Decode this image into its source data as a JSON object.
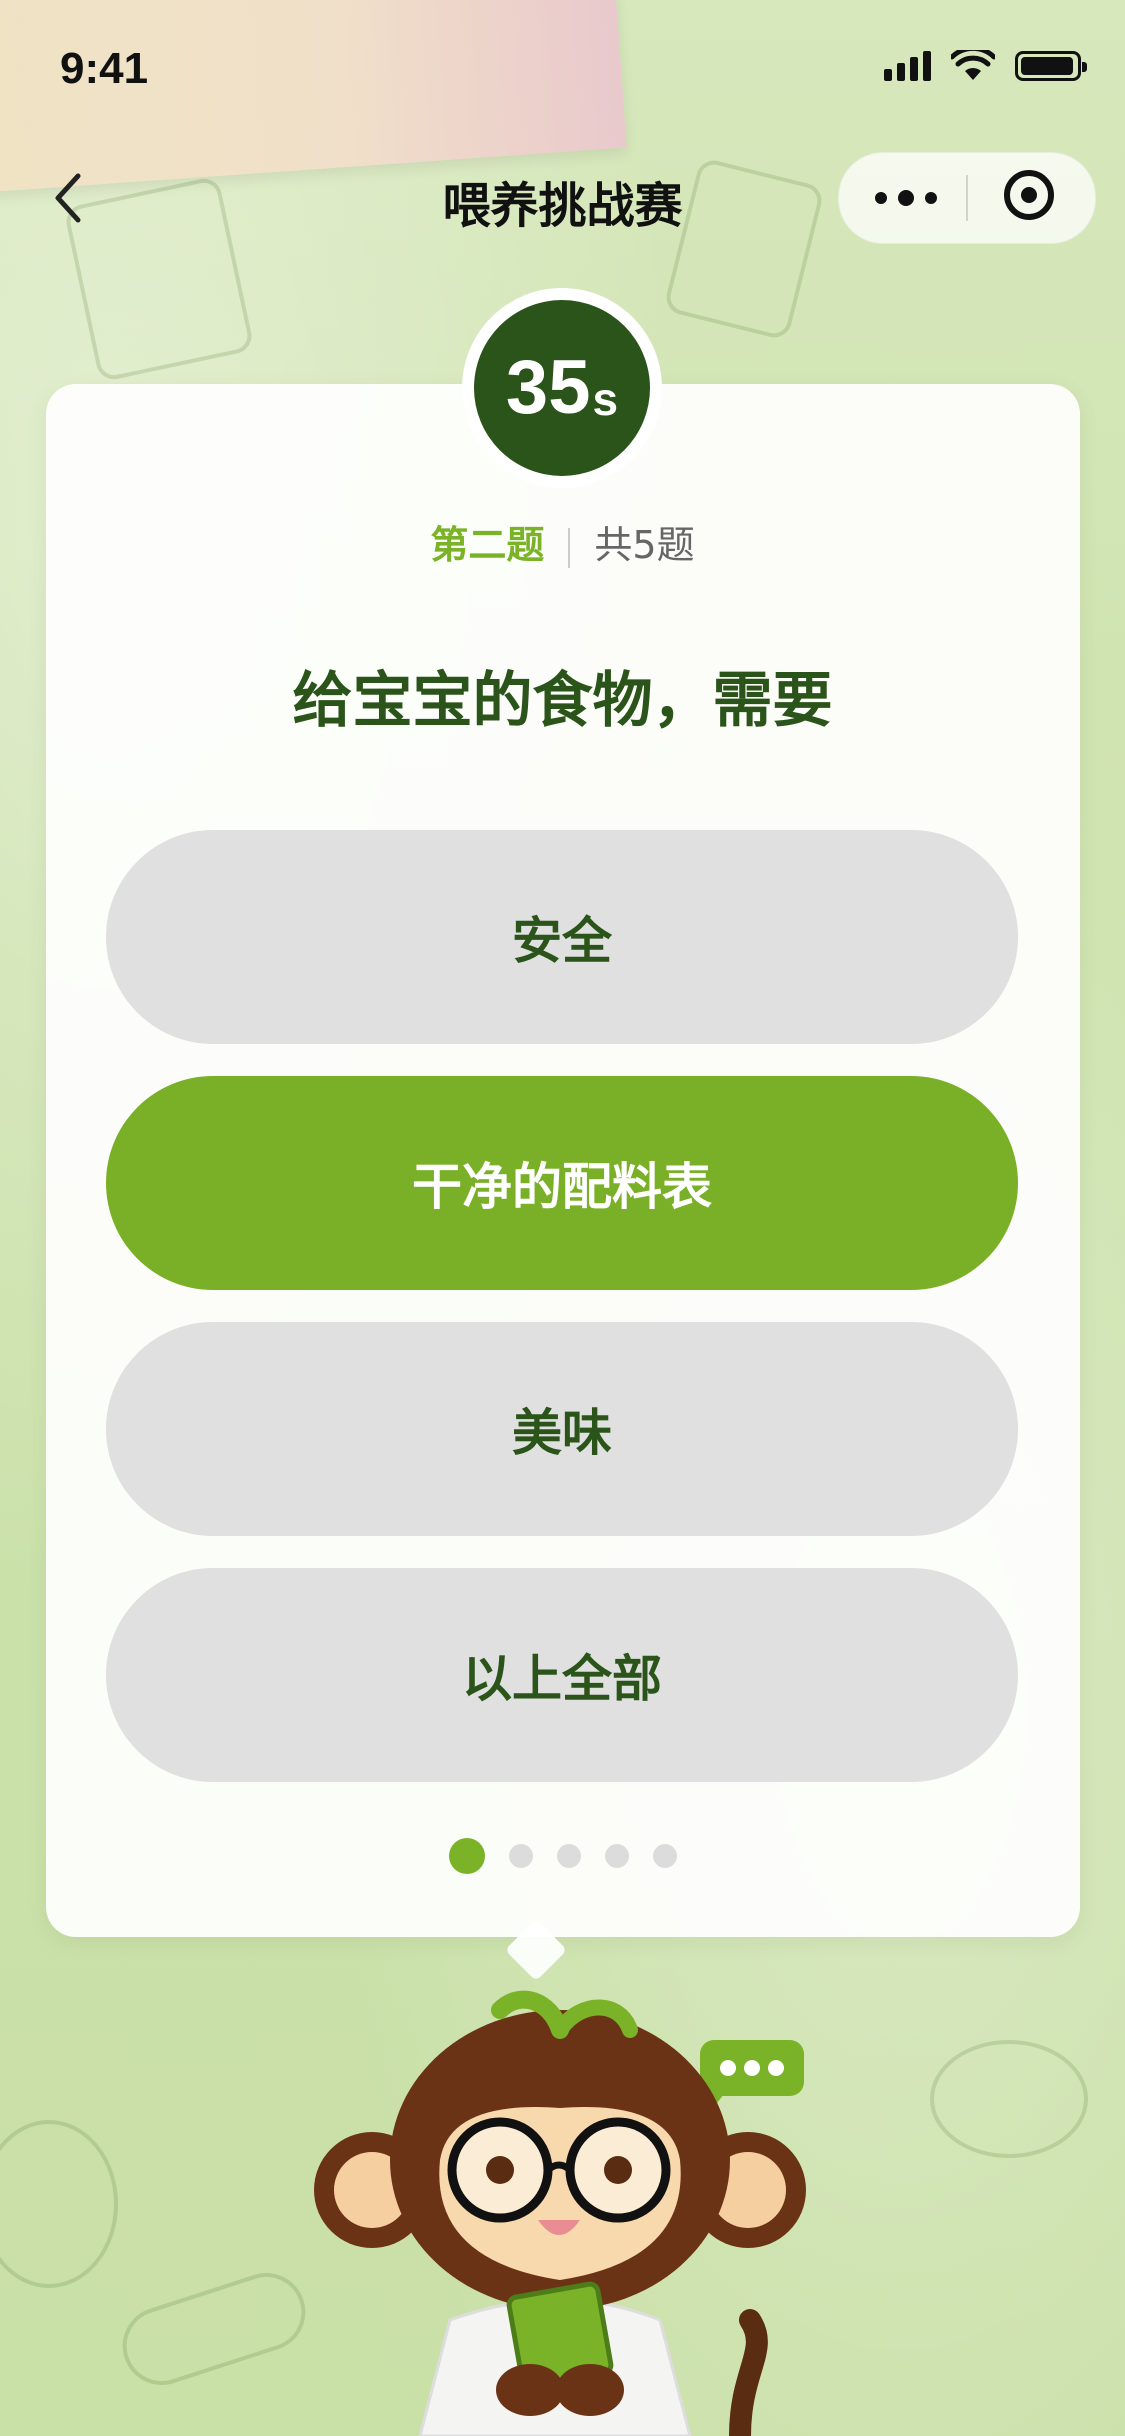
{
  "status_bar": {
    "time": "9:41"
  },
  "nav": {
    "title": "喂养挑战赛"
  },
  "timer": {
    "value": "35",
    "unit": "s"
  },
  "progress": {
    "current": "第二题",
    "total": "共5题",
    "current_index": 1,
    "count": 5
  },
  "question": {
    "text": "给宝宝的食物，需要"
  },
  "options": [
    {
      "label": "安全",
      "selected": false
    },
    {
      "label": "干净的配料表",
      "selected": true
    },
    {
      "label": "美味",
      "selected": false
    },
    {
      "label": "以上全部",
      "selected": false
    }
  ],
  "colors": {
    "primary_green": "#7ab228",
    "dark_green": "#2a5419",
    "option_bg": "#e0e0e0"
  },
  "icons": {
    "back": "chevron-left-icon",
    "more": "more-dots-icon",
    "close": "target-close-icon",
    "chat": "chat-bubble-icon"
  }
}
